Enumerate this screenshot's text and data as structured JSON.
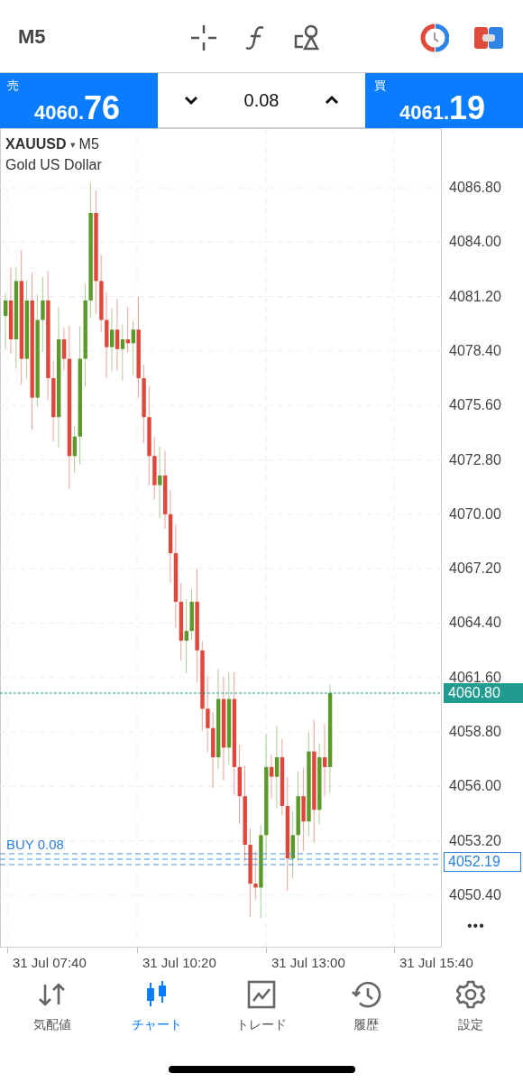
{
  "top_bar": {
    "timeframe": "M5"
  },
  "trade_panel": {
    "sell": {
      "label": "売",
      "price_small": "4060.",
      "price_big": "76"
    },
    "volume": "0.08",
    "buy": {
      "label": "買",
      "price_small": "4061.",
      "price_big": "19"
    }
  },
  "chart": {
    "symbol": "XAUUSD",
    "symbol_caret": "▾",
    "timeframe": "M5",
    "description": "Gold US Dollar",
    "price_ticks": [
      "4086.80",
      "4084.00",
      "4081.20",
      "4078.40",
      "4075.60",
      "4072.80",
      "4070.00",
      "4067.20",
      "4064.40",
      "4061.60",
      "4058.80",
      "4056.00",
      "4053.20",
      "4050.40"
    ],
    "current_price": "4060.80",
    "order_label": "BUY 0.08",
    "order_price": "4052.19",
    "more": "•••",
    "time_ticks": [
      "31 Jul 07:40",
      "31 Jul 10:20",
      "31 Jul 13:00",
      "31 Jul 15:40"
    ]
  },
  "nav": [
    {
      "kind": "quotes",
      "label": "気配値",
      "selected": false
    },
    {
      "kind": "chart",
      "label": "チャート",
      "selected": true
    },
    {
      "kind": "trade",
      "label": "トレード",
      "selected": false
    },
    {
      "kind": "history",
      "label": "履歴",
      "selected": false
    },
    {
      "kind": "settings",
      "label": "設定",
      "selected": false
    }
  ]
}
